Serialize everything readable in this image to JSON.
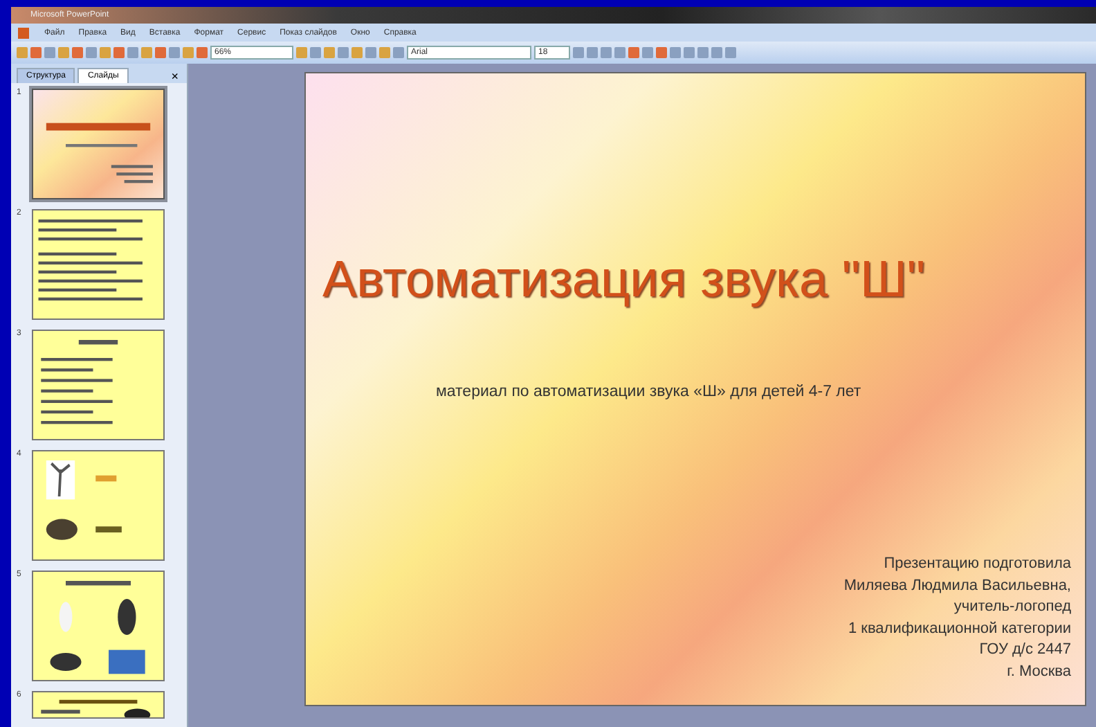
{
  "window": {
    "title": "Microsoft PowerPoint"
  },
  "menu": [
    "Файл",
    "Правка",
    "Вид",
    "Вставка",
    "Формат",
    "Сервис",
    "Показ слайдов",
    "Окно",
    "Справка"
  ],
  "toolbar": {
    "zoom": "66%",
    "font": "Arial",
    "font_size": "18"
  },
  "side_panel": {
    "tabs": [
      {
        "label": "Структура",
        "selected": false
      },
      {
        "label": "Слайды",
        "selected": true
      }
    ],
    "close": "×",
    "thumbnails": [
      {
        "number": "1",
        "kind": "title",
        "selected": true
      },
      {
        "number": "2",
        "kind": "text",
        "selected": false
      },
      {
        "number": "3",
        "kind": "list",
        "selected": false
      },
      {
        "number": "4",
        "kind": "pictures",
        "selected": false
      },
      {
        "number": "5",
        "kind": "grid",
        "selected": false
      },
      {
        "number": "6",
        "kind": "partial",
        "selected": false
      }
    ]
  },
  "slide": {
    "title": "Автоматизация звука \"Ш\"",
    "subtitle": "материал по автоматизации звука «Ш» для детей 4-7 лет",
    "author_lines": [
      "Презентацию подготовила",
      "Миляева Людмила Васильевна,",
      "учитель-логопед",
      "1 квалификационной категории",
      "ГОУ д/с 2447",
      "г. Москва"
    ]
  }
}
